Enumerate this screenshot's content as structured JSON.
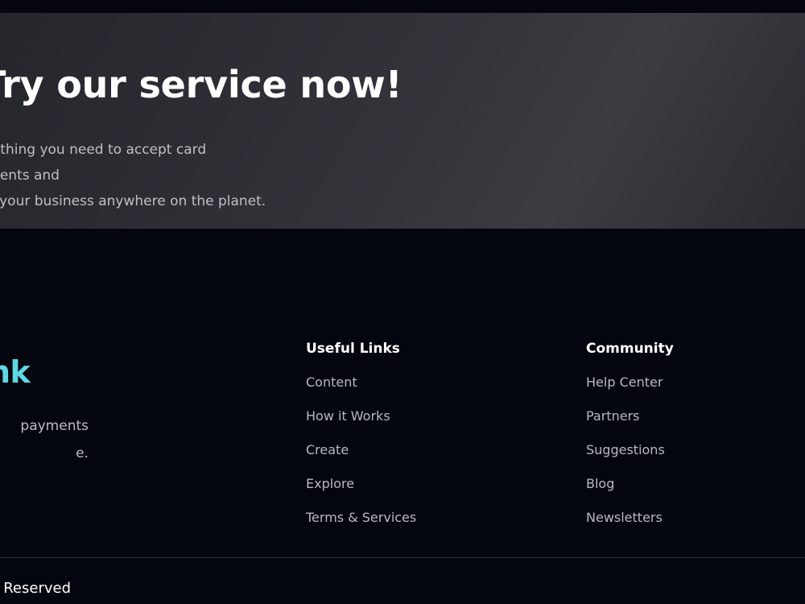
{
  "cta": {
    "title": "Try our service now!",
    "description": "Everything you need to accept card payments and\ngrow your business anywhere on the planet."
  },
  "brand": {
    "logo_text": "nk",
    "description": "payments\ne."
  },
  "useful_links": {
    "heading": "Useful Links",
    "items": [
      {
        "label": "Content"
      },
      {
        "label": "How it Works"
      },
      {
        "label": "Create"
      },
      {
        "label": "Explore"
      },
      {
        "label": "Terms & Services"
      }
    ]
  },
  "community": {
    "heading": "Community",
    "items": [
      {
        "label": "Help Center"
      },
      {
        "label": "Partners"
      },
      {
        "label": "Suggestions"
      },
      {
        "label": "Blog"
      },
      {
        "label": "Newsletters"
      }
    ]
  },
  "footer": {
    "copyright": "Reserved"
  },
  "colors": {
    "background": "#04060f",
    "accent": "#5fd8e4",
    "cta_panel": "#34343b"
  }
}
